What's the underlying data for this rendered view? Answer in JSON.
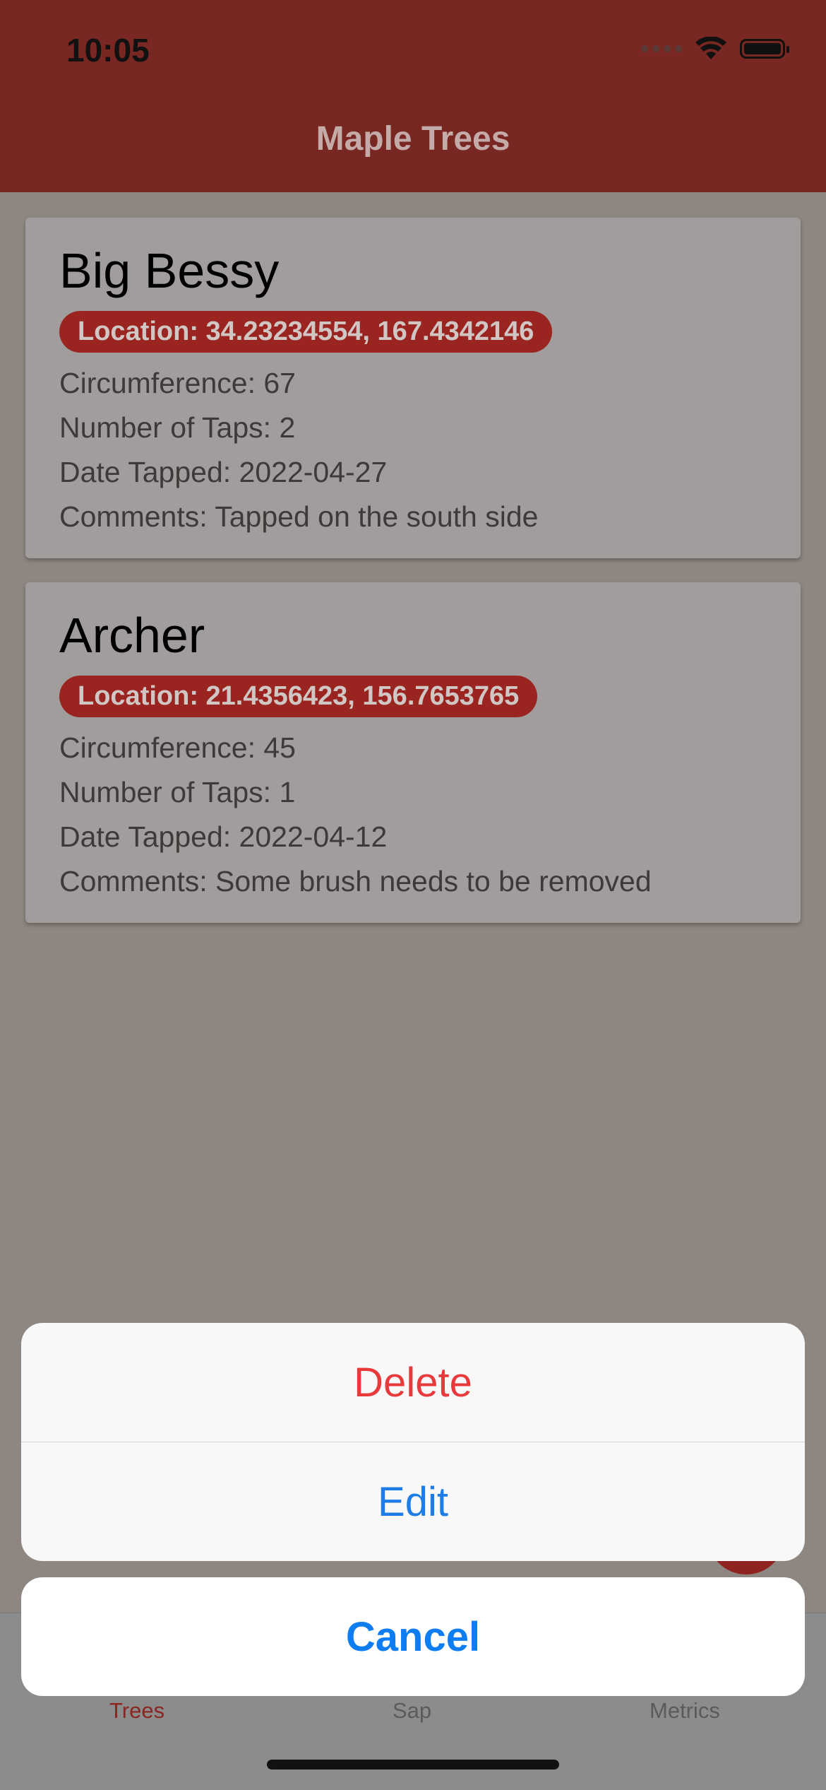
{
  "status_bar": {
    "time": "10:05"
  },
  "nav": {
    "title": "Maple Trees"
  },
  "trees": [
    {
      "name": "Big Bessy",
      "location": "Location: 34.23234554, 167.4342146",
      "circumference": "Circumference: 67",
      "taps": "Number of Taps: 2",
      "date": "Date Tapped: 2022-04-27",
      "comments": "Comments: Tapped on the south side"
    },
    {
      "name": "Archer",
      "location": "Location: 21.4356423, 156.7653765",
      "circumference": "Circumference: 45",
      "taps": "Number of Taps: 1",
      "date": "Date Tapped: 2022-04-12",
      "comments": "Comments: Some brush needs to be removed"
    }
  ],
  "tabs": [
    {
      "label": "Trees",
      "active": true
    },
    {
      "label": "Sap",
      "active": false
    },
    {
      "label": "Metrics",
      "active": false
    }
  ],
  "action_sheet": {
    "delete_label": "Delete",
    "edit_label": "Edit",
    "cancel_label": "Cancel"
  },
  "colors": {
    "header": "#782723",
    "badge": "#9a2520",
    "destructive": "#e8393c",
    "action": "#1e7ce6"
  }
}
